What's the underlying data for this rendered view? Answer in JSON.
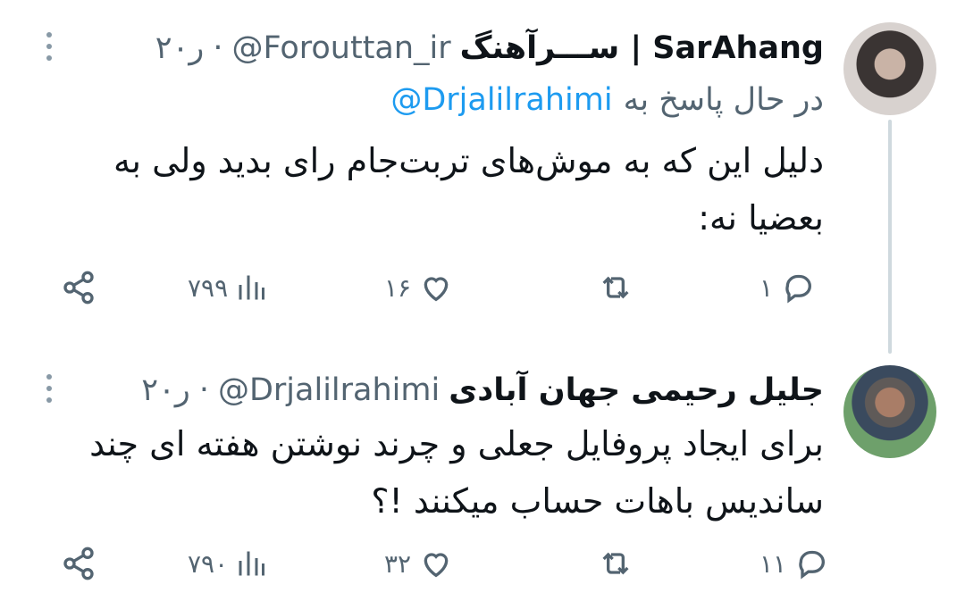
{
  "tweets": [
    {
      "name": "ســـرآهنگ | SarAhang",
      "handle": "@Forouttan_ir",
      "dot": "·",
      "time": "۲۰ر",
      "replying_prefix": "در حال پاسخ به",
      "replying_to": "@Drjalilrahimi",
      "text": "دلیل این که به موش‌های تربت‌جام رای بدید ولی به بعضیا نه:",
      "reply_count": "۱",
      "retweet_count": "",
      "like_count": "۱۶",
      "view_count": "۷۹۹"
    },
    {
      "name": "جلیل رحیمی جهان آبادی",
      "handle": "@Drjalilrahimi",
      "dot": "·",
      "time": "۲۰ر",
      "text": "برای ایجاد پروفایل جعلی و چرند نوشتن هفته ای چند ساندیس باهات حساب میکنند !؟",
      "reply_count": "۱۱",
      "retweet_count": "",
      "like_count": "۳۲",
      "view_count": "۷۹۰"
    }
  ],
  "icons": {
    "reply": "reply-icon",
    "retweet": "retweet-icon",
    "like": "like-icon",
    "views": "views-icon",
    "share": "share-icon",
    "more": "more-icon"
  },
  "colors": {
    "text": "#0f1419",
    "secondary": "#536471",
    "mention": "#1d9bf0",
    "thread_line": "#cfd9de"
  }
}
